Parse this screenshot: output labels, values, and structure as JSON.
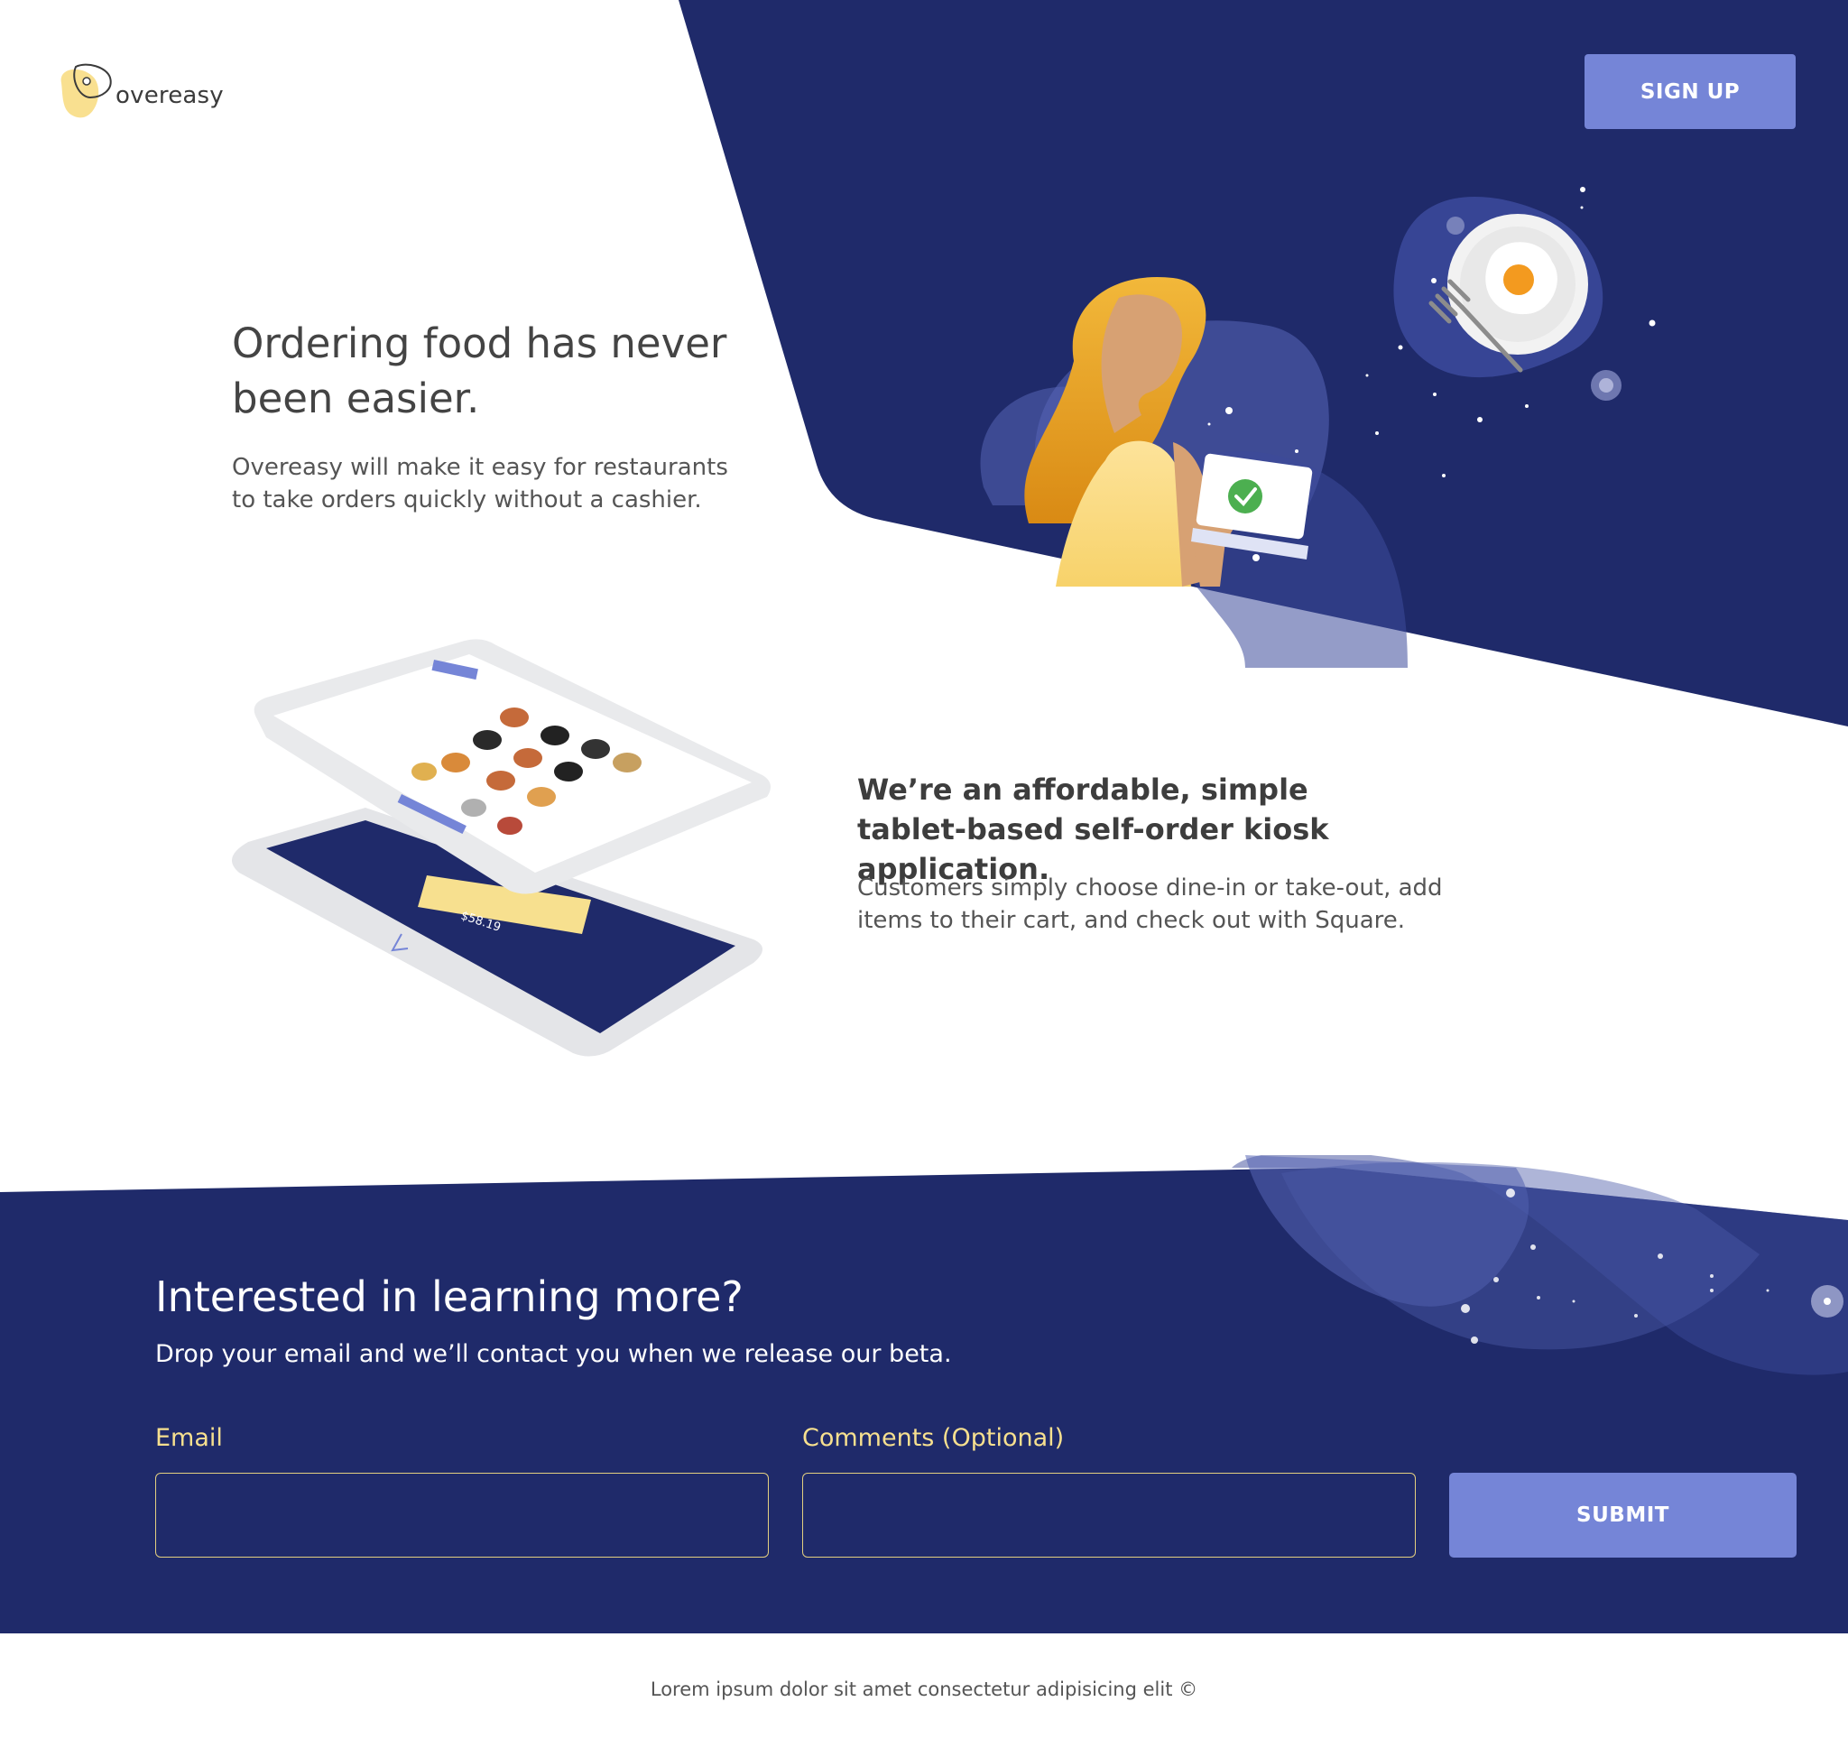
{
  "colors": {
    "navy": "#1f2a6a",
    "accent": "#7585d7",
    "label_yellow": "#f7e08f",
    "text_dark": "#444444"
  },
  "header": {
    "logo_text": "overeasy",
    "signup_label": "SIGN UP"
  },
  "hero": {
    "title": "Ordering food has never been easier.",
    "subtitle": "Overeasy will make it easy for restaurants to take orders quickly without a cashier."
  },
  "feature": {
    "title": "We’re an affordable, simple tablet-based self-order kiosk application.",
    "subtitle": "Customers simply choose dine-in or take-out, add items to their cart, and check out with Square."
  },
  "signup": {
    "title": "Interested in learning more?",
    "subtitle": "Drop your email and we’ll contact you when we release our beta.",
    "email_label": "Email",
    "comments_label": "Comments (Optional)",
    "submit_label": "SUBMIT"
  },
  "footer": {
    "text": "Lorem ipsum dolor sit amet consectetur adipisicing elit ©"
  }
}
